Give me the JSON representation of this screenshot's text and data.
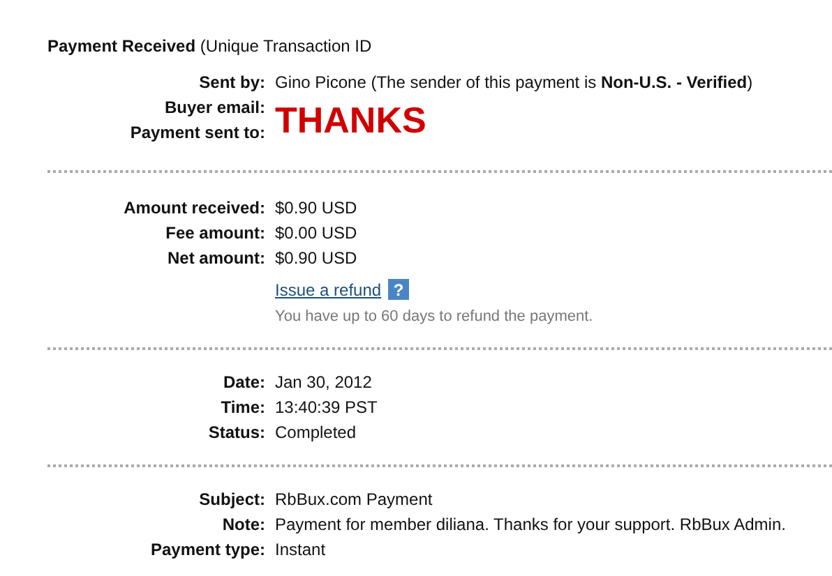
{
  "header": {
    "title": "Payment Received",
    "subtitle": "(Unique Transaction ID"
  },
  "sections": [
    {
      "rows": [
        {
          "kind": "field",
          "label": "Sent by:",
          "value": "Gino Picone (The sender of this payment is **Non-U.S. - Verified**)"
        },
        {
          "kind": "stamp",
          "label": "Buyer email:",
          "value": "THANKS"
        },
        {
          "kind": "label",
          "label": "Payment sent to:"
        }
      ]
    },
    {
      "rows": [
        {
          "kind": "field",
          "label": "Amount received:",
          "value": "$0.90 USD"
        },
        {
          "kind": "field",
          "label": "Fee amount:",
          "value": "$0.00 USD"
        },
        {
          "kind": "field",
          "label": "Net amount:",
          "value": "$0.90 USD"
        },
        {
          "kind": "link",
          "value": "Issue a refund",
          "help": "?"
        },
        {
          "kind": "hint",
          "value": "You have up to 60 days to refund the payment."
        }
      ]
    },
    {
      "rows": [
        {
          "kind": "field",
          "label": "Date:",
          "value": "Jan 30, 2012"
        },
        {
          "kind": "field",
          "label": "Time:",
          "value": "13:40:39 PST"
        },
        {
          "kind": "field",
          "label": "Status:",
          "value": "Completed"
        }
      ]
    },
    {
      "rows": [
        {
          "kind": "field",
          "label": "Subject:",
          "value": "RbBux.com Payment"
        },
        {
          "kind": "field",
          "label": "Note:",
          "value": "Payment for member diliana. Thanks for your support. RbBux Admin."
        },
        {
          "kind": "field",
          "label": "Payment type:",
          "value": "Instant"
        }
      ]
    }
  ]
}
